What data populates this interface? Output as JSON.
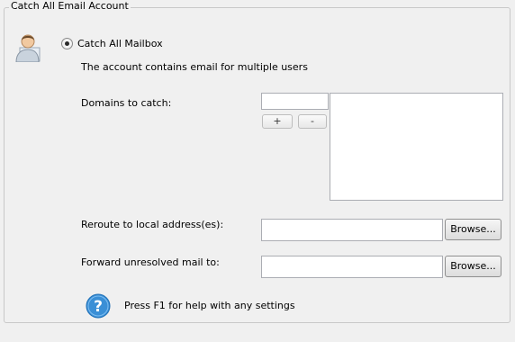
{
  "group": {
    "title": "Catch All Email Account"
  },
  "icons": {
    "user": "user-avatar-icon",
    "help": "question-mark-help-icon"
  },
  "mode": {
    "label": "Catch All Mailbox",
    "selected": true
  },
  "description": "The account contains email for multiple users",
  "domains": {
    "label": "Domains to catch:",
    "input_value": "",
    "add_label": "+",
    "remove_label": "-",
    "items": []
  },
  "reroute": {
    "label": "Reroute to local address(es):",
    "value": "",
    "browse_label": "Browse..."
  },
  "forward": {
    "label": "Forward unresolved mail to:",
    "value": "",
    "browse_label": "Browse..."
  },
  "help": {
    "text": "Press F1 for help with any settings"
  },
  "colors": {
    "help_blue": "#3a8fd6",
    "border": "#abadb3"
  }
}
